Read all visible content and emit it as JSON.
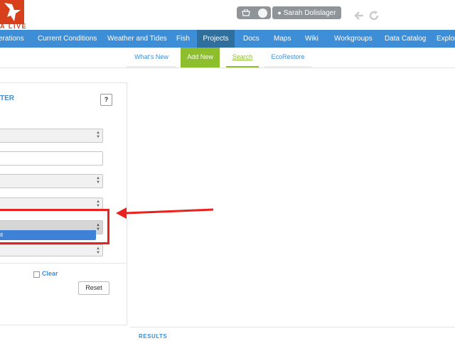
{
  "header": {
    "logo_text": "A LIVE",
    "user_name": "Sarah Dolislager",
    "icons": {
      "logo": "bird-logo-icon",
      "basket": "basket-icon",
      "user": "user-icon",
      "back": "back-arrow-icon",
      "refresh": "refresh-icon"
    }
  },
  "main_nav": {
    "items": [
      {
        "label": "erations"
      },
      {
        "label": "Current Conditions"
      },
      {
        "label": "Weather and Tides"
      },
      {
        "label": "Fish"
      },
      {
        "label": "Projects",
        "active": true
      },
      {
        "label": "Docs"
      },
      {
        "label": "Maps"
      },
      {
        "label": "Wiki"
      },
      {
        "label": "Workgroups"
      },
      {
        "label": "Data Catalog"
      },
      {
        "label": "Explor"
      }
    ]
  },
  "sub_nav": {
    "items": [
      {
        "label": "What's New"
      },
      {
        "label": "Add New",
        "active": true
      },
      {
        "label": "Search",
        "current": true
      },
      {
        "label": "EcoRestore"
      }
    ]
  },
  "filter": {
    "heading": "TER",
    "help_label": "?",
    "dropdown_option": "ent",
    "clear_label": "Clear",
    "reset_label": "Reset"
  },
  "results": {
    "heading": "RESULTS"
  },
  "colors": {
    "nav": "#3d8ed6",
    "nav_active": "#2f6f9e",
    "subnav_active": "#8cbf2b",
    "link": "#3d8ed6",
    "annotation": "#e8231f",
    "selected_option": "#3d82d6"
  }
}
